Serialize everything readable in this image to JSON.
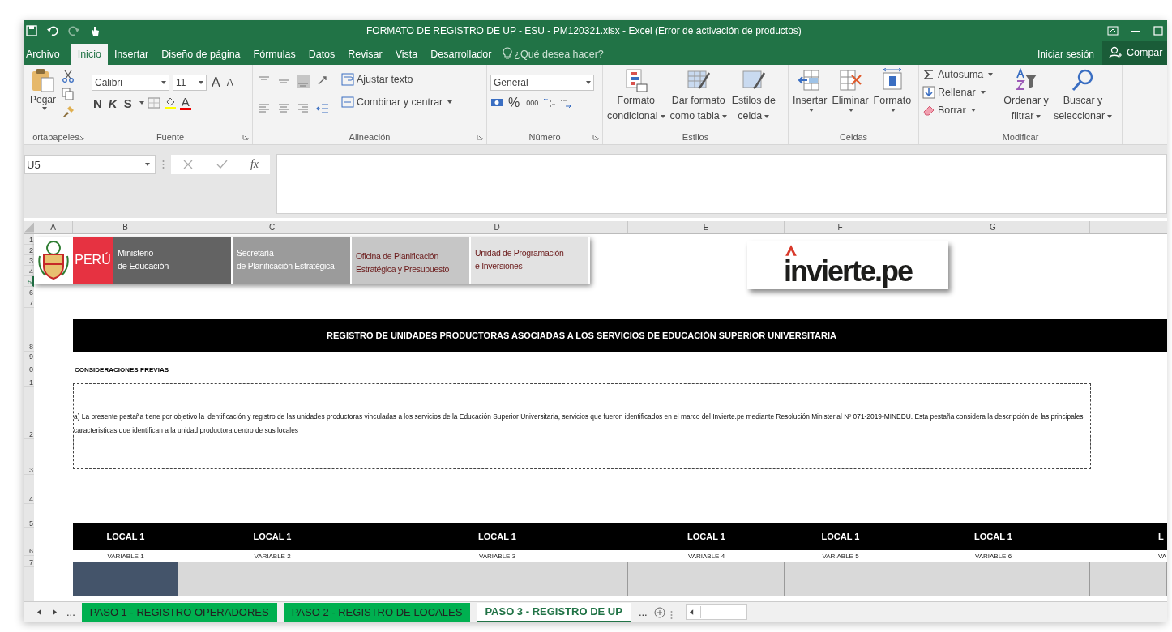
{
  "window": {
    "title": "FORMATO DE REGISTRO DE UP - ESU - PM120321.xlsx - Excel (Error de activación de productos)"
  },
  "ribbon_tabs": [
    {
      "label": "Archivo",
      "selected": false
    },
    {
      "label": "Inicio",
      "selected": true
    },
    {
      "label": "Insertar",
      "selected": false
    },
    {
      "label": "Diseño de página",
      "selected": false
    },
    {
      "label": "Fórmulas",
      "selected": false
    },
    {
      "label": "Datos",
      "selected": false
    },
    {
      "label": "Revisar",
      "selected": false
    },
    {
      "label": "Vista",
      "selected": false
    },
    {
      "label": "Desarrollador",
      "selected": false
    }
  ],
  "tell_me": {
    "placeholder": "¿Qué desea hacer?"
  },
  "account": {
    "sign_in": "Iniciar sesión",
    "share": "Compar"
  },
  "ribbon": {
    "clipboard": {
      "label": "ortapapeles",
      "paste": "Pegar"
    },
    "font": {
      "label": "Fuente",
      "font_name": "Calibri",
      "font_size": "11",
      "grow": "A",
      "shrink": "A",
      "bold": "N",
      "italic": "K",
      "underline": "S",
      "font_color": "A"
    },
    "alignment": {
      "label": "Alineación",
      "wrap": "Ajustar texto",
      "merge": "Combinar y centrar"
    },
    "number": {
      "label": "Número",
      "format": "General",
      "percent": "%",
      "thousands": "000"
    },
    "styles": {
      "label": "Estilos",
      "buttons": [
        {
          "lines": [
            "Formato",
            "condicional"
          ]
        },
        {
          "lines": [
            "Dar formato",
            "como tabla"
          ]
        },
        {
          "lines": [
            "Estilos de",
            "celda"
          ]
        }
      ]
    },
    "cells": {
      "label": "Celdas",
      "buttons": [
        {
          "lines": [
            "Insertar"
          ]
        },
        {
          "lines": [
            "Eliminar"
          ]
        },
        {
          "lines": [
            "Formato"
          ]
        }
      ]
    },
    "editing": {
      "label": "Modificar",
      "small": [
        "Autosuma",
        "Rellenar",
        "Borrar"
      ],
      "buttons": [
        {
          "lines": [
            "Ordenar y",
            "filtrar"
          ]
        },
        {
          "lines": [
            "Buscar y",
            "seleccionar"
          ]
        }
      ]
    }
  },
  "formula_bar": {
    "name_box": "U5",
    "function_label": "fx"
  },
  "columns": [
    "A",
    "B",
    "C",
    "D",
    "E",
    "F",
    "G"
  ],
  "row_headers": [
    "1",
    "2",
    "3",
    "4",
    "5",
    "6",
    "7",
    "8",
    "9",
    "0",
    "1",
    "2",
    "3",
    "4",
    "5",
    "6",
    "7"
  ],
  "banner": {
    "country": "PERÚ",
    "entities": [
      {
        "lines": [
          "Ministerio",
          "de Educación"
        ]
      },
      {
        "lines": [
          "Secretaría",
          "de Planificación Estratégica"
        ]
      },
      {
        "lines": [
          "Oficina de Planificación",
          "Estratégica y Presupuesto"
        ]
      },
      {
        "lines": [
          "Unidad de Programación",
          "e Inversiones"
        ]
      }
    ]
  },
  "logo": {
    "text": "invierte.pe"
  },
  "sheet": {
    "title": "REGISTRO DE UNIDADES PRODUCTORAS ASOCIADAS A LOS SERVICIOS DE EDUCACIÓN SUPERIOR UNIVERSITARIA",
    "considerations_heading": "CONSIDERACIONES PREVIAS",
    "considerations_text": "a) La presente pestaña tiene por objetivo la identificación y registro  de las unidades productoras vinculadas a los servicios de la Educación Superior Universitaria, servicios que fueron identificados en el marco del Invierte.pe mediante Resolución Ministerial Nº 071-2019-MINEDU. Esta pestaña considera la descripción de las principales caracteristicas que identifican a la unidad productora dentro de sus locales",
    "table_columns": [
      {
        "local": "LOCAL 1",
        "variable": "VARIABLE 1",
        "color": "#44546a"
      },
      {
        "local": "LOCAL 1",
        "variable": "VARIABLE 2",
        "color": "#d9d9d9"
      },
      {
        "local": "LOCAL 1",
        "variable": "VARIABLE 3",
        "color": "#d9d9d9"
      },
      {
        "local": "LOCAL 1",
        "variable": "VARIABLE 4",
        "color": "#d9d9d9"
      },
      {
        "local": "LOCAL 1",
        "variable": "VARIABLE 5",
        "color": "#d9d9d9"
      },
      {
        "local": "LOCAL 1",
        "variable": "VARIABLE 6",
        "color": "#d9d9d9"
      },
      {
        "local": "L",
        "variable": "VA",
        "color": "#d9d9d9"
      }
    ]
  },
  "sheet_tabs": {
    "more_left": "...",
    "more_right": "...",
    "tabs": [
      {
        "label": "PASO 1 - REGISTRO OPERADORES",
        "selected": false
      },
      {
        "label": "PASO 2 - REGISTRO DE LOCALES",
        "selected": false
      },
      {
        "label": "PASO 3 - REGISTRO DE UP",
        "selected": true
      }
    ]
  }
}
